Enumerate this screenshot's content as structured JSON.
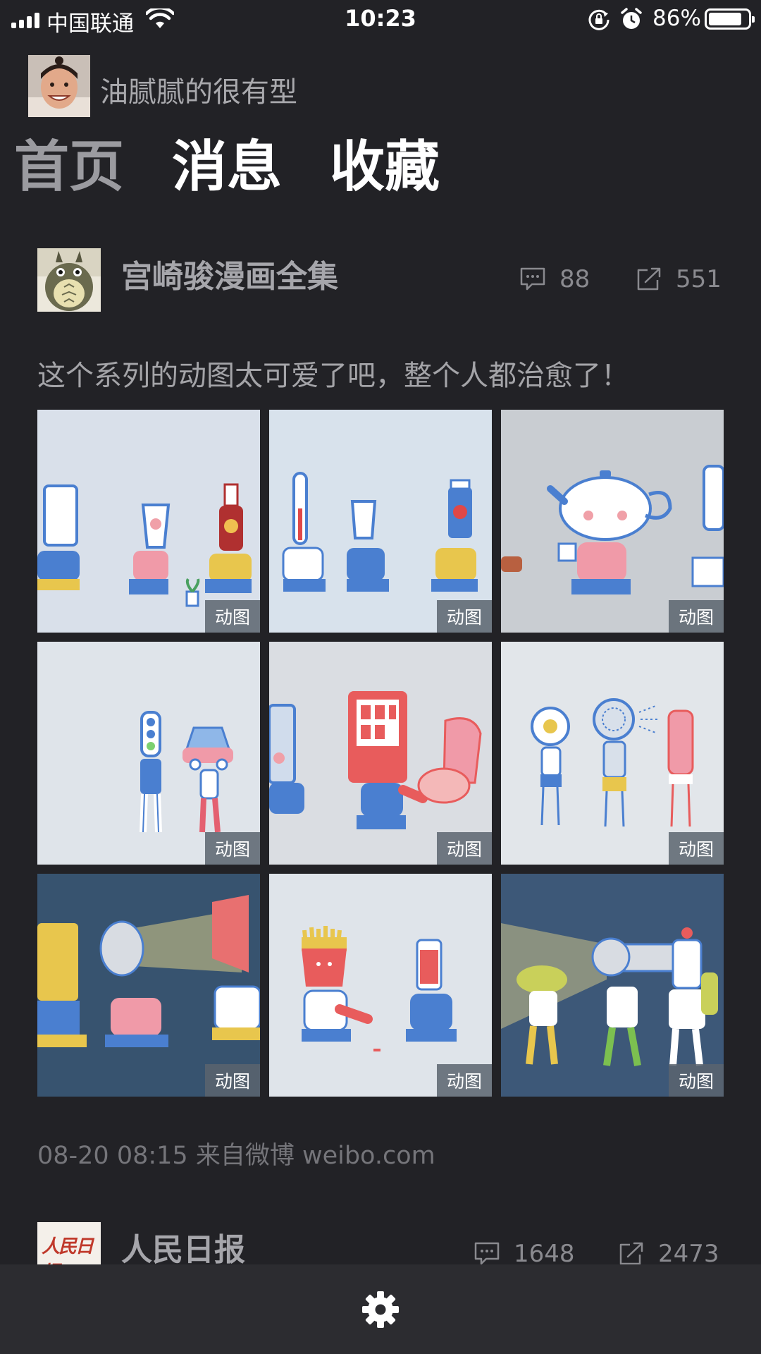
{
  "status_bar": {
    "carrier": "中国联通",
    "time": "10:23",
    "battery_percent": "86%",
    "battery_level": 0.86,
    "icons": [
      "signal-icon",
      "wifi-icon",
      "rotation-lock-icon",
      "alarm-icon",
      "battery-icon"
    ]
  },
  "profile": {
    "name": "油腻腻的很有型"
  },
  "tabs": [
    {
      "label": "首页",
      "active": false
    },
    {
      "label": "消息",
      "active": true
    },
    {
      "label": "收藏",
      "active": true
    }
  ],
  "post": {
    "author": "宫崎骏漫画全集",
    "comments": "88",
    "reposts": "551",
    "text": "这个系列的动图太可爱了吧，整个人都治愈了！",
    "gif_badge": "动图",
    "image_count": 9,
    "meta": "08-20 08:15   来自微博 weibo.com"
  },
  "post2": {
    "author": "人民日报",
    "comments": "1648",
    "reposts": "2473",
    "avatar_logo": "人民日报"
  },
  "bottom_bar": {
    "settings_icon": "gear-icon"
  },
  "colors": {
    "background": "#222226",
    "bottom_bar": "#2c2c30",
    "muted_text": "#a6a6ab"
  }
}
